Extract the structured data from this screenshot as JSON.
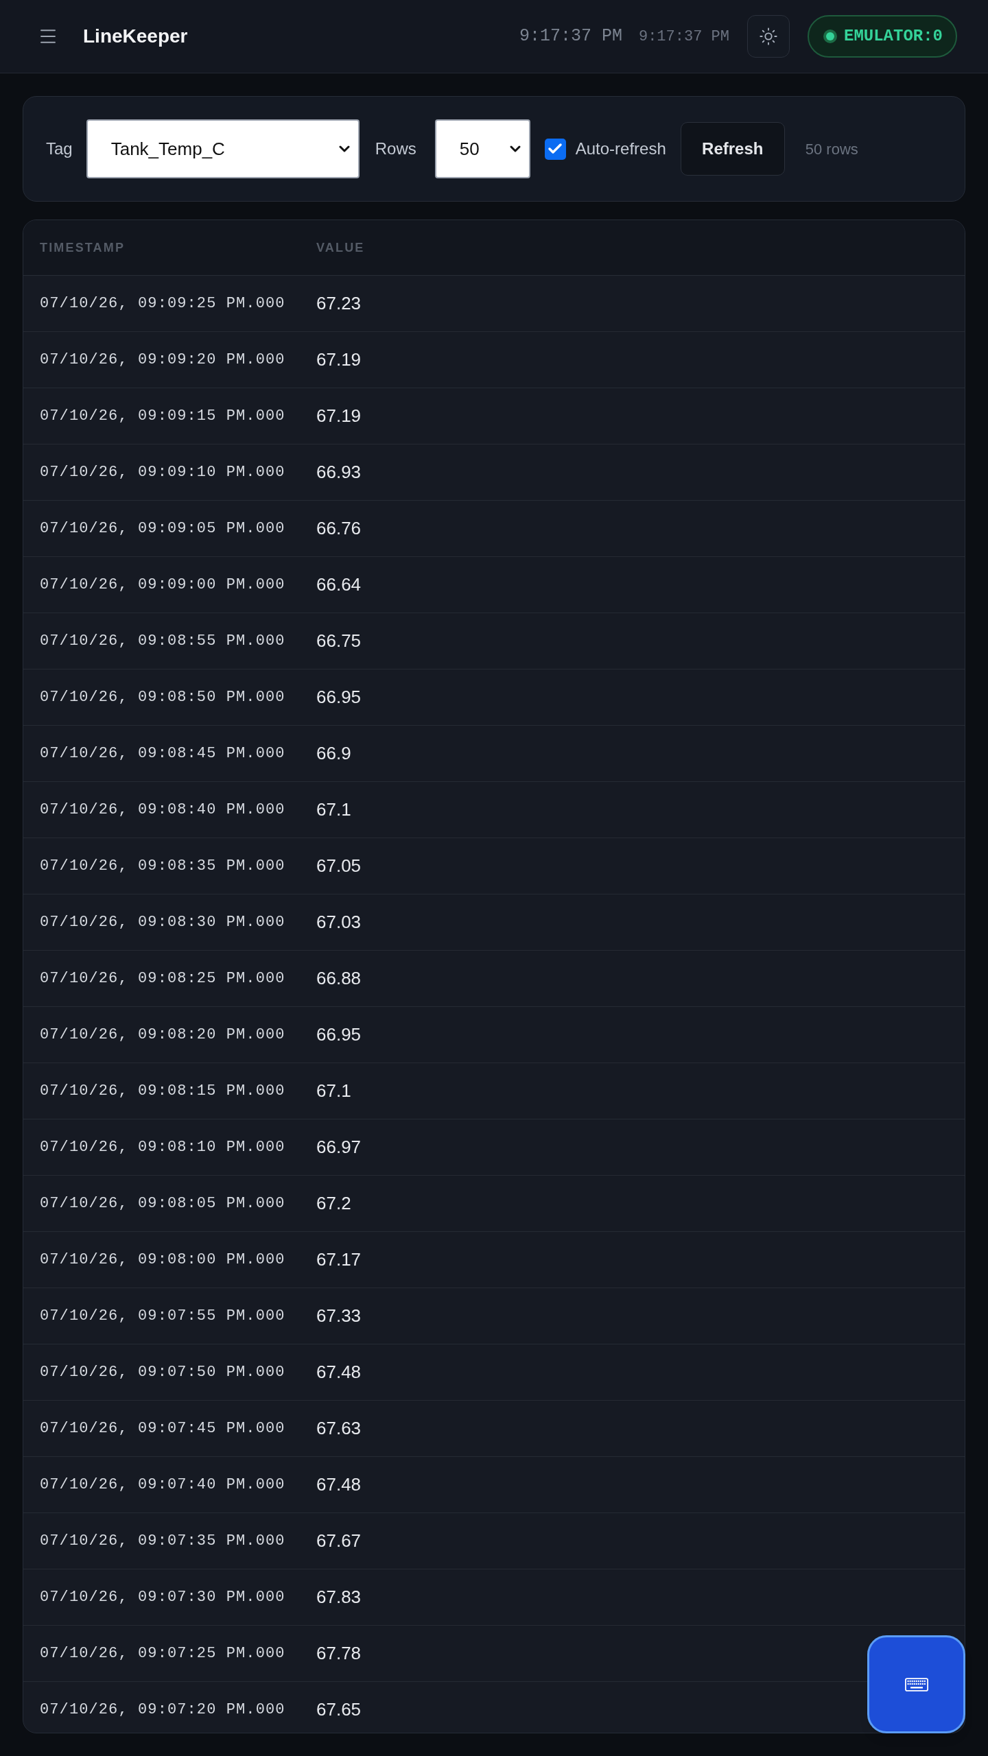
{
  "header": {
    "title": "LineKeeper",
    "clock_primary": "9:17:37 PM",
    "clock_secondary": "9:17:37 PM",
    "connection": {
      "label": "EMULATOR:0",
      "connected": true
    }
  },
  "controls": {
    "tag": {
      "label": "Tag",
      "value": "Tank_Temp_C"
    },
    "rows": {
      "label": "Rows",
      "value": "50"
    },
    "auto_refresh": {
      "label": "Auto-refresh",
      "checked": true
    },
    "refresh_button": "Refresh",
    "row_count": "50 rows"
  },
  "table": {
    "columns": [
      "TIMESTAMP",
      "VALUE"
    ],
    "rows": [
      {
        "timestamp": "07/10/26, 09:09:25 PM.000",
        "value": "67.23"
      },
      {
        "timestamp": "07/10/26, 09:09:20 PM.000",
        "value": "67.19"
      },
      {
        "timestamp": "07/10/26, 09:09:15 PM.000",
        "value": "67.19"
      },
      {
        "timestamp": "07/10/26, 09:09:10 PM.000",
        "value": "66.93"
      },
      {
        "timestamp": "07/10/26, 09:09:05 PM.000",
        "value": "66.76"
      },
      {
        "timestamp": "07/10/26, 09:09:00 PM.000",
        "value": "66.64"
      },
      {
        "timestamp": "07/10/26, 09:08:55 PM.000",
        "value": "66.75"
      },
      {
        "timestamp": "07/10/26, 09:08:50 PM.000",
        "value": "66.95"
      },
      {
        "timestamp": "07/10/26, 09:08:45 PM.000",
        "value": "66.9"
      },
      {
        "timestamp": "07/10/26, 09:08:40 PM.000",
        "value": "67.1"
      },
      {
        "timestamp": "07/10/26, 09:08:35 PM.000",
        "value": "67.05"
      },
      {
        "timestamp": "07/10/26, 09:08:30 PM.000",
        "value": "67.03"
      },
      {
        "timestamp": "07/10/26, 09:08:25 PM.000",
        "value": "66.88"
      },
      {
        "timestamp": "07/10/26, 09:08:20 PM.000",
        "value": "66.95"
      },
      {
        "timestamp": "07/10/26, 09:08:15 PM.000",
        "value": "67.1"
      },
      {
        "timestamp": "07/10/26, 09:08:10 PM.000",
        "value": "66.97"
      },
      {
        "timestamp": "07/10/26, 09:08:05 PM.000",
        "value": "67.2"
      },
      {
        "timestamp": "07/10/26, 09:08:00 PM.000",
        "value": "67.17"
      },
      {
        "timestamp": "07/10/26, 09:07:55 PM.000",
        "value": "67.33"
      },
      {
        "timestamp": "07/10/26, 09:07:50 PM.000",
        "value": "67.48"
      },
      {
        "timestamp": "07/10/26, 09:07:45 PM.000",
        "value": "67.63"
      },
      {
        "timestamp": "07/10/26, 09:07:40 PM.000",
        "value": "67.48"
      },
      {
        "timestamp": "07/10/26, 09:07:35 PM.000",
        "value": "67.67"
      },
      {
        "timestamp": "07/10/26, 09:07:30 PM.000",
        "value": "67.83"
      },
      {
        "timestamp": "07/10/26, 09:07:25 PM.000",
        "value": "67.78"
      },
      {
        "timestamp": "07/10/26, 09:07:20 PM.000",
        "value": "67.65"
      }
    ]
  }
}
